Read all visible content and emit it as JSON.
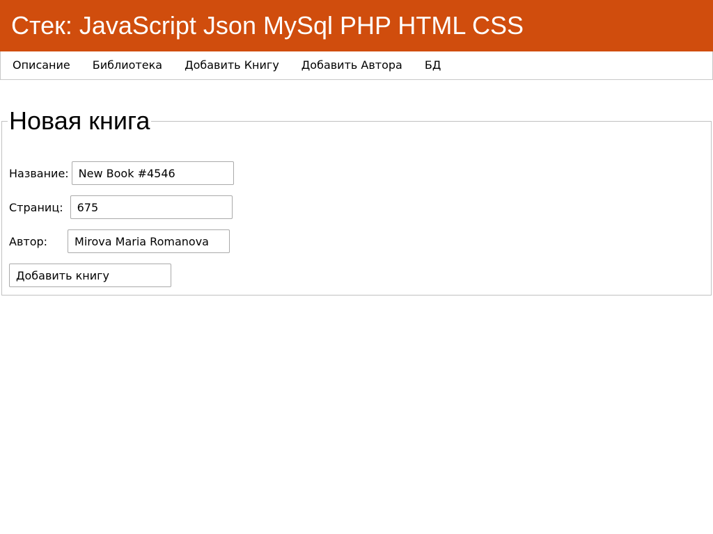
{
  "header": {
    "title": "Стек: JavaScript Json MySql PHP HTML CSS",
    "background_color": "#d04d0d"
  },
  "nav": {
    "items": [
      {
        "label": "Описание"
      },
      {
        "label": "Библиотека"
      },
      {
        "label": "Добавить Книгу"
      },
      {
        "label": "Добавить Автора"
      },
      {
        "label": "БД"
      }
    ]
  },
  "form": {
    "legend": "Новая книга",
    "fields": {
      "title": {
        "label": "Название:",
        "value": "New Book #4546"
      },
      "pages": {
        "label": "Страниц:",
        "value": "675"
      },
      "author": {
        "label": "Автор:",
        "value": "Mirova Maria Romanova"
      }
    },
    "submit_label": "Добавить книгу"
  }
}
